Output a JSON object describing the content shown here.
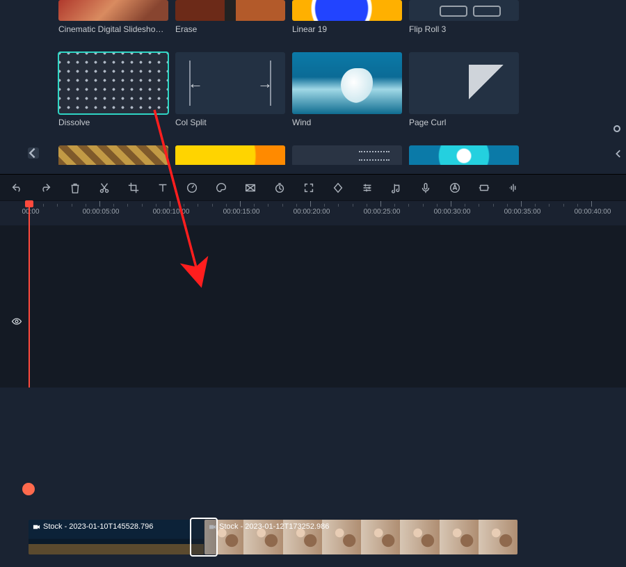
{
  "transitions": {
    "row1": [
      {
        "label": "Cinematic Digital Slideshow ..."
      },
      {
        "label": "Erase"
      },
      {
        "label": "Linear 19"
      },
      {
        "label": "Flip Roll 3"
      }
    ],
    "row2": [
      {
        "label": "Dissolve",
        "selected": true
      },
      {
        "label": "Col Split"
      },
      {
        "label": "Wind"
      },
      {
        "label": "Page Curl"
      }
    ]
  },
  "toolbar": {
    "undo": "undo",
    "redo": "redo",
    "delete": "delete",
    "cut": "cut",
    "crop": "crop",
    "text": "text",
    "speed": "speed",
    "color": "color",
    "mask": "mask",
    "timer": "timer",
    "fit": "fit",
    "key": "key",
    "adjust": "adjust",
    "audio_detach": "audio_detach",
    "voice": "voice",
    "ai": "ai",
    "stabilize": "stabilize",
    "denoise": "denoise"
  },
  "ruler": {
    "marks": [
      {
        "t": "00:00"
      },
      {
        "t": "00:00:05:00"
      },
      {
        "t": "00:00:10:00"
      },
      {
        "t": "00:00:15:00"
      },
      {
        "t": "00:00:20:00"
      },
      {
        "t": "00:00:25:00"
      },
      {
        "t": "00:00:30:00"
      },
      {
        "t": "00:00:35:00"
      },
      {
        "t": "00:00:40:00"
      }
    ]
  },
  "clips": {
    "clip1_title": "Stock - 2023-01-10T145528.796",
    "clip2_title": "Stock - 2023-01-12T173252.986"
  },
  "colors": {
    "accent": "#2fd5c4",
    "playhead": "#ff4a3d",
    "audio": "#2bb59d"
  }
}
